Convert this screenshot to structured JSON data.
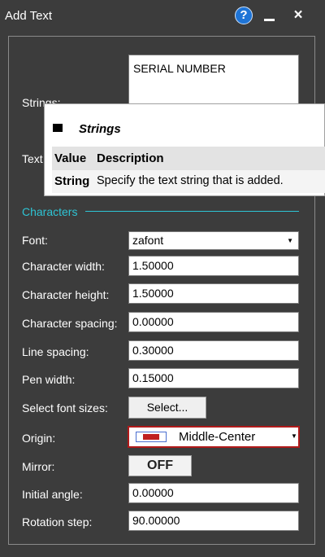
{
  "window": {
    "title": "Add Text",
    "help_glyph": "?",
    "close_glyph": "×"
  },
  "strings": {
    "label": "Strings:",
    "value": "SERIAL NUMBER"
  },
  "text_label_partial": "Text",
  "tooltip": {
    "title": "Strings",
    "header_value": "Value",
    "header_description": "Description",
    "row_value": "String",
    "row_description": "Specify the text string that is added."
  },
  "section_characters": "Characters",
  "font": {
    "label": "Font:",
    "value": "zafont"
  },
  "character_width": {
    "label": "Character width:",
    "value": "1.50000"
  },
  "character_height": {
    "label": "Character height:",
    "value": "1.50000"
  },
  "character_spacing": {
    "label": "Character spacing:",
    "value": "0.00000"
  },
  "line_spacing": {
    "label": "Line spacing:",
    "value": "0.30000"
  },
  "pen_width": {
    "label": "Pen width:",
    "value": "0.15000"
  },
  "select_font_sizes": {
    "label": "Select font sizes:",
    "button": "Select..."
  },
  "origin": {
    "label": "Origin:",
    "value": "Middle-Center"
  },
  "mirror": {
    "label": "Mirror:",
    "value": "OFF"
  },
  "initial_angle": {
    "label": "Initial angle:",
    "value": "0.00000"
  },
  "rotation_step": {
    "label": "Rotation step:",
    "value": "90.00000"
  },
  "colors": {
    "accent": "#2ec4d4",
    "background": "#3c3c3c",
    "origin_border": "#b01a1a"
  }
}
